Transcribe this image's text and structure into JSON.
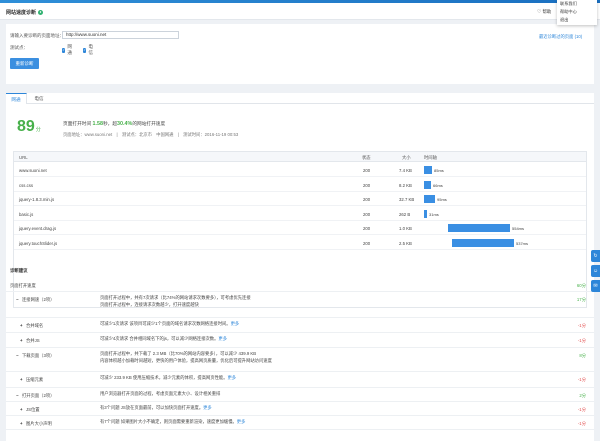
{
  "header": {
    "title": "网站速度诊断",
    "badge": "♦",
    "help": "帮助",
    "dropdown": [
      "联系我们",
      "帮助中心",
      "退出"
    ]
  },
  "form": {
    "url_label": "请输入要诊断的页面地址：",
    "url_value": "http://www.suoni.net",
    "test_label": "测试点：",
    "options": [
      "网通",
      "电信"
    ],
    "start_button": "重新诊断",
    "recent_link": "最近诊断过的页面 (10)"
  },
  "tabs": [
    "网通",
    "电信"
  ],
  "result": {
    "score": "89",
    "score_unit": "分",
    "summary_prefix": "页面打开时间",
    "time": "1.58",
    "time_unit": "秒，超",
    "percent": "30.4%",
    "summary_suffix": "的网站打开速度",
    "meta": "页面地址：www.suoni.net　|　测试点：北京市　中国网通　|　测试时间：2016-11-19 00:53"
  },
  "table": {
    "headers": [
      "URL",
      "状态",
      "大小",
      "时间轴"
    ],
    "rows": [
      {
        "url": "www.suoni.net",
        "status": "200",
        "size": "7.4 KB",
        "time": "85ms"
      },
      {
        "url": "css.css",
        "status": "200",
        "size": "8.2 KB",
        "time": "66ms"
      },
      {
        "url": "jquery-1.8.3.min.js",
        "status": "200",
        "size": "32.7 KB",
        "time": "95ms"
      },
      {
        "url": "basic.js",
        "status": "200",
        "size": "262 B",
        "time": "31ms"
      },
      {
        "url": "jquery.event.drag.js",
        "status": "200",
        "size": "1.0 KB",
        "time": "554ms"
      },
      {
        "url": "jquery.touchSlider.js",
        "status": "200",
        "size": "2.5 KB",
        "time": "537ms"
      }
    ]
  },
  "analysis": {
    "title": "诊断建议",
    "overall_label": "页面打开速度",
    "overall_score": "60分",
    "items": [
      {
        "sign": "−",
        "name": "连接网速（2项）",
        "desc": [
          "页面打开过程中，共有7次请求（比74%的网站请求次数要多），可考虑优先连接",
          "页面打开过程中，连接请求次数越少，打开速度越快"
        ],
        "score": "17分",
        "color": "green"
      },
      {
        "sign": "+",
        "name": "合并域名",
        "desc": [
          "可减少1次请求 该项目可减少1个页面的域名请求次数网络连接时间。",
          "更多"
        ],
        "score": "-1分",
        "color": "red"
      },
      {
        "sign": "+",
        "name": "合并JS",
        "desc": [
          "可减少4次请求 合并相同域名下的js，可以减少网络连接次数。",
          "更多"
        ],
        "score": "-1分",
        "color": "red"
      },
      {
        "sign": "−",
        "name": "下载页面（3项）",
        "desc": [
          "页面打开过程中，共下载了 2.3 MB（比70%的网站内容要多），可以减少 439.9 KB",
          "内容体积越小加载时间越短，更快的用户体验，提高网页质量，优化后可提升网站访问速度"
        ],
        "score": "8分",
        "color": "green"
      },
      {
        "sign": "+",
        "name": "压缩元素",
        "desc": [
          "可减少 233.9 KB 使用压缩技术，减少元素的体积，提高网页性能。",
          "更多"
        ],
        "score": "-1分",
        "color": "red"
      },
      {
        "sign": "−",
        "name": "打开页面（2项）",
        "desc": [
          "用户浏览器打开页面的过程，考虑页面元素大小、设计相关重排"
        ],
        "score": "2分",
        "color": "green"
      },
      {
        "sign": "+",
        "name": "JS位置",
        "desc": [
          "有3个问题 JS放在页面最前，可以加快页面打开速度。",
          "更多"
        ],
        "score": "-1分",
        "color": "red"
      },
      {
        "sign": "+",
        "name": "图片大小声明",
        "desc": [
          "有7个问题 如果图片大小不确定，则页面需要重新渲染，速度更加缓慢。",
          "更多"
        ],
        "score": "-1分",
        "color": "red"
      }
    ]
  },
  "side_buttons": [
    "↻",
    "☺",
    "✉"
  ],
  "colors": {
    "accent": "#2d86d9",
    "good": "#47b04a",
    "bad": "#e34f4f"
  }
}
